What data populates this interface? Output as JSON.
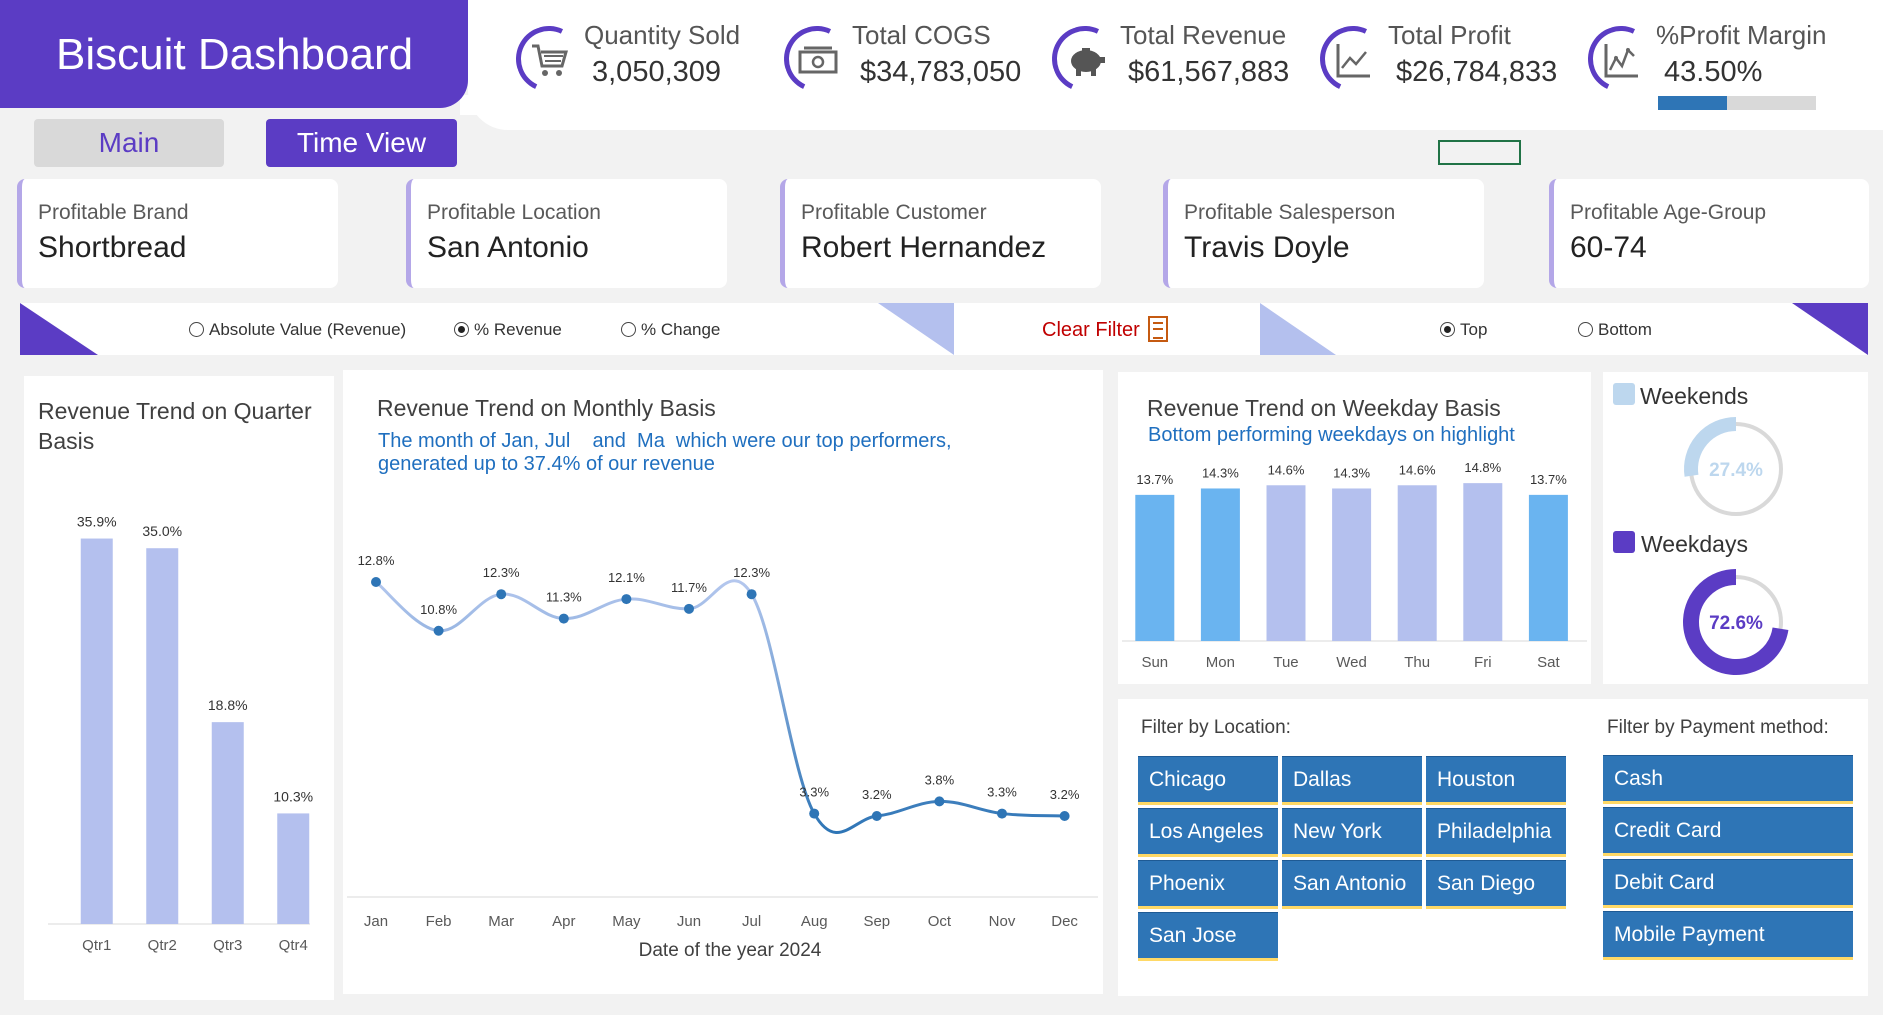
{
  "title": "Biscuit Dashboard",
  "kpis": [
    {
      "label": "Quantity Sold",
      "value": "3,050,309",
      "icon": "shopping-cart-icon"
    },
    {
      "label": "Total COGS",
      "value": "$34,783,050",
      "icon": "cash-icon"
    },
    {
      "label": "Total Revenue",
      "value": "$61,567,883",
      "icon": "piggy-bank-icon"
    },
    {
      "label": "Total Profit",
      "value": "$26,784,833",
      "icon": "line-chart-icon"
    },
    {
      "label": "%Profit Margin",
      "value": "43.50%",
      "icon": "trend-chart-icon",
      "progress": 0.435
    }
  ],
  "nav": {
    "main": "Main",
    "time_view": "Time View"
  },
  "profitable": [
    {
      "label": "Profitable Brand",
      "value": "Shortbread"
    },
    {
      "label": "Profitable Location",
      "value": "San Antonio"
    },
    {
      "label": "Profitable Customer",
      "value": "Robert Hernandez"
    },
    {
      "label": "Profitable Salesperson",
      "value": "Travis Doyle"
    },
    {
      "label": "Profitable Age-Group",
      "value": "60-74"
    }
  ],
  "measure_options": [
    {
      "label": "Absolute Value (Revenue)",
      "selected": false
    },
    {
      "label": "% Revenue",
      "selected": true
    },
    {
      "label": "% Change",
      "selected": false
    }
  ],
  "clear_filter": "Clear Filter",
  "rank_options": [
    {
      "label": "Top",
      "selected": true
    },
    {
      "label": "Bottom",
      "selected": false
    }
  ],
  "quarter_chart": {
    "title": "Revenue Trend on Quarter Basis",
    "labels": [
      "35.9%",
      "35.0%",
      "18.8%",
      "10.3%"
    ]
  },
  "monthly_chart": {
    "title": "Revenue Trend on Monthly Basis",
    "subtitle_line1": "The month of Jan, Jul    and  Ma  which were our top performers,",
    "subtitle_line2": "generated up to 37.4% of our revenue",
    "xlabel": "Date of the year 2024",
    "labels": [
      "12.8%",
      "10.8%",
      "12.3%",
      "11.3%",
      "12.1%",
      "11.7%",
      "12.3%",
      "3.3%",
      "3.2%",
      "3.8%",
      "3.3%",
      "3.2%"
    ]
  },
  "weekday_chart": {
    "title": "Revenue Trend on Weekday Basis",
    "subtitle": "Bottom performing weekdays on highlight",
    "labels": [
      "13.7%",
      "14.3%",
      "14.6%",
      "14.3%",
      "14.6%",
      "14.8%",
      "13.7%"
    ]
  },
  "donuts": {
    "weekends": {
      "label": "Weekends",
      "value": "27.4%",
      "fraction": 0.274,
      "color": "#bdd7ee"
    },
    "weekdays": {
      "label": "Weekdays",
      "value": "72.6%",
      "fraction": 0.726,
      "color": "#5b3cc4"
    }
  },
  "filter_location": {
    "label": "Filter by Location:",
    "items": [
      "Chicago",
      "Dallas",
      "Houston",
      "Los Angeles",
      "New York",
      "Philadelphia",
      "Phoenix",
      "San Antonio",
      "San Diego",
      "San Jose"
    ]
  },
  "filter_payment": {
    "label": "Filter by Payment method:",
    "items": [
      "Cash",
      "Credit Card",
      "Debit Card",
      "Mobile Payment"
    ]
  },
  "colors": {
    "accent": "#5b3cc4",
    "bar_light": "#b4c0ee",
    "bar_highlight": "#6ab4f0",
    "line_blue": "#2e75b6",
    "button_blue": "#2e75b6"
  },
  "chart_data": [
    {
      "type": "bar",
      "title": "Revenue Trend on Quarter Basis",
      "categories": [
        "Qtr1",
        "Qtr2",
        "Qtr3",
        "Qtr4"
      ],
      "values": [
        35.9,
        35.0,
        18.8,
        10.3
      ],
      "ylim": [
        0,
        38
      ]
    },
    {
      "type": "line",
      "title": "Revenue Trend on Monthly Basis",
      "xlabel": "Date of the year 2024",
      "x": [
        "Jan",
        "Feb",
        "Mar",
        "Apr",
        "May",
        "Jun",
        "Jul",
        "Aug",
        "Sep",
        "Oct",
        "Nov",
        "Dec"
      ],
      "values": [
        12.8,
        10.8,
        12.3,
        11.3,
        12.1,
        11.7,
        12.3,
        3.3,
        3.2,
        3.8,
        3.3,
        3.2
      ],
      "ylim": [
        0,
        14
      ]
    },
    {
      "type": "bar",
      "title": "Revenue Trend on Weekday Basis",
      "categories": [
        "Sun",
        "Mon",
        "Tue",
        "Wed",
        "Thu",
        "Fri",
        "Sat"
      ],
      "values": [
        13.7,
        14.3,
        14.6,
        14.3,
        14.6,
        14.8,
        13.7
      ],
      "highlight": [
        true,
        true,
        false,
        false,
        false,
        false,
        true
      ],
      "ylim": [
        0,
        15
      ]
    },
    {
      "type": "pie",
      "categories": [
        "Weekends",
        "Weekdays"
      ],
      "values": [
        27.4,
        72.6
      ]
    }
  ]
}
